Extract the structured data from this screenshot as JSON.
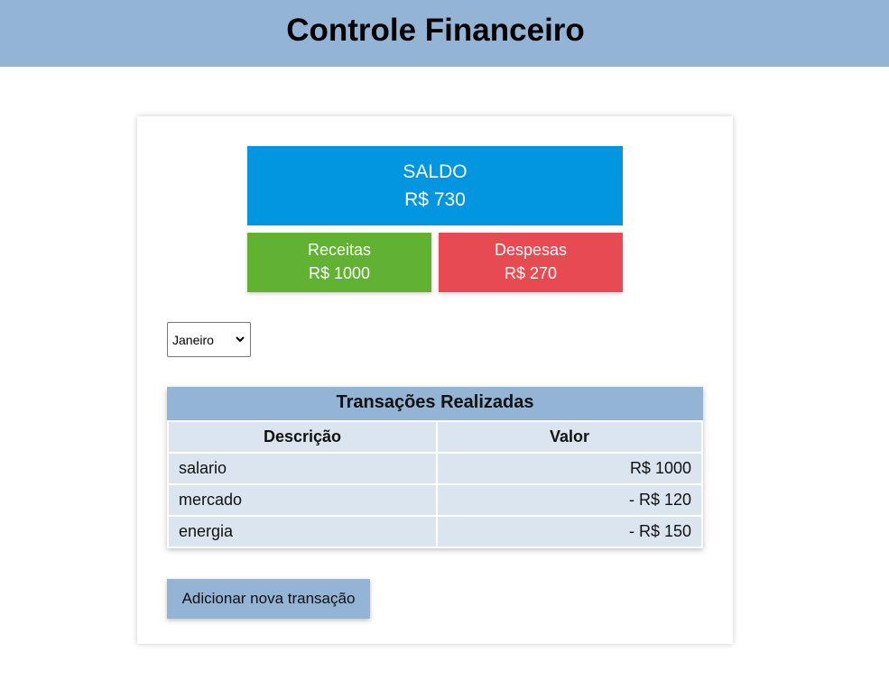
{
  "header": {
    "title": "Controle Financeiro"
  },
  "summary": {
    "saldo_label": "SALDO",
    "saldo_value": "R$ 730",
    "receitas_label": "Receitas",
    "receitas_value": "R$ 1000",
    "despesas_label": "Despesas",
    "despesas_value": "R$ 270"
  },
  "month_select": {
    "selected": "Janeiro",
    "icon": "chevron-down-icon"
  },
  "table": {
    "caption": "Transações Realizadas",
    "headers": [
      "Descrição",
      "Valor"
    ],
    "rows": [
      {
        "descricao": "salario",
        "valor": "R$ 1000"
      },
      {
        "descricao": "mercado",
        "valor": "- R$ 120"
      },
      {
        "descricao": "energia",
        "valor": "- R$ 150"
      }
    ]
  },
  "actions": {
    "add_label": "Adicionar nova transação"
  },
  "colors": {
    "header_bg": "#94b4d5",
    "saldo_bg": "#0295e0",
    "receitas_bg": "#61b132",
    "despesas_bg": "#e84a52",
    "table_cell_bg": "#dbe5f0"
  }
}
